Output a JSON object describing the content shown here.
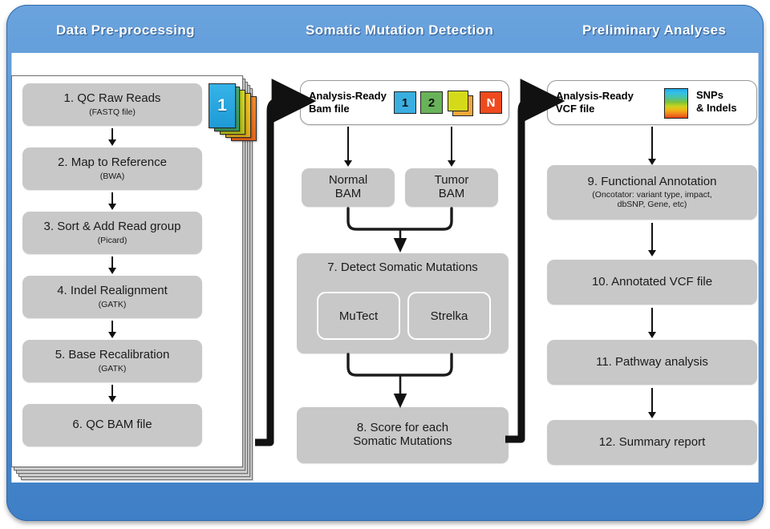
{
  "diagram": {
    "title": "Somatic mutation analysis workflow",
    "colors": {
      "frame_blue": "#5795d6",
      "process_grey": "#c8c8c8",
      "connector_black": "#111111",
      "chip_blue": "#3aaee0",
      "chip_green": "#68b359",
      "chip_yellow": "#d4da1a",
      "chip_orange": "#f0a83a",
      "chip_red": "#ef4a1e"
    }
  },
  "headers": [
    {
      "label": "Data Pre-processing"
    },
    {
      "label": "Somatic Mutation Detection"
    },
    {
      "label": "Preliminary Analyses"
    }
  ],
  "preprocessing": {
    "card_stack_top_label": "1",
    "steps": [
      {
        "title": "1. QC Raw Reads",
        "sub": "(FASTQ file)"
      },
      {
        "title": "2. Map to Reference",
        "sub": "(BWA)"
      },
      {
        "title": "3. Sort & Add Read group",
        "sub": "(Picard)"
      },
      {
        "title": "4. Indel Realignment",
        "sub": "(GATK)"
      },
      {
        "title": "5. Base Recalibration",
        "sub": "(GATK)"
      },
      {
        "title": "6. QC BAM file",
        "sub": ""
      }
    ]
  },
  "detection": {
    "input_file": {
      "label": "Analysis-Ready\nBam file"
    },
    "chips": [
      {
        "label": "1",
        "color": "#3aaee0"
      },
      {
        "label": "2",
        "color": "#68b359"
      },
      {
        "label": "",
        "color": "#d4da1a"
      },
      {
        "label": "N",
        "color": "#ef4a1e"
      }
    ],
    "branches": [
      {
        "title": "Normal\nBAM"
      },
      {
        "title": "Tumor\nBAM"
      }
    ],
    "detect_step": {
      "title": "7. Detect Somatic  Mutations",
      "tools": [
        {
          "label": "MuTect"
        },
        {
          "label": "Strelka"
        }
      ]
    },
    "score_step": {
      "title": "8. Score for each\nSomatic Mutations"
    }
  },
  "analyses": {
    "input_file": {
      "label": "Analysis-Ready\nVCF file"
    },
    "legend": {
      "label": "SNPs\n& Indels"
    },
    "steps": [
      {
        "title": "9. Functional Annotation",
        "sub": "(Oncotator: variant type, impact,\ndbSNP, Gene, etc)"
      },
      {
        "title": "10. Annotated VCF file",
        "sub": ""
      },
      {
        "title": "11. Pathway analysis",
        "sub": ""
      },
      {
        "title": "12. Summary report",
        "sub": ""
      }
    ]
  }
}
